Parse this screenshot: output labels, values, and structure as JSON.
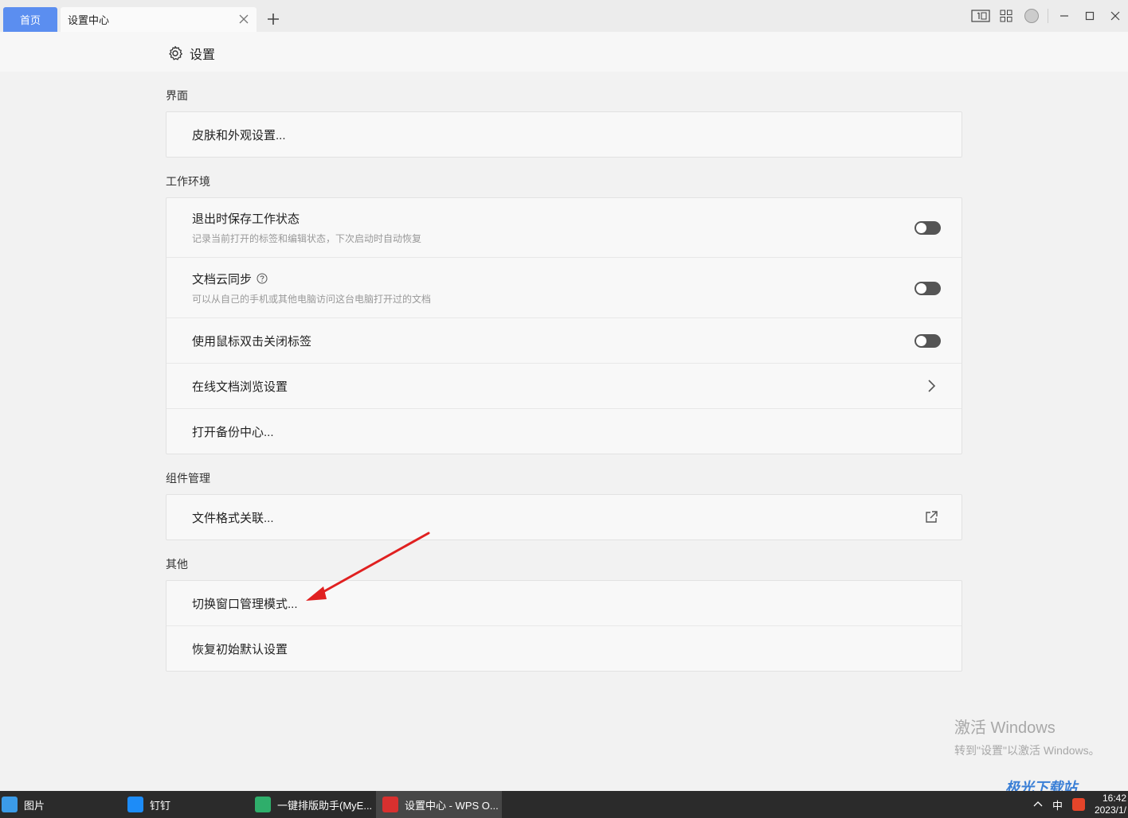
{
  "titlebar": {
    "home_tab": "首页",
    "active_tab": "设置中心"
  },
  "header": {
    "title": "设置"
  },
  "sections": {
    "interface": {
      "title": "界面",
      "skin": "皮肤和外观设置..."
    },
    "workspace": {
      "title": "工作环境",
      "save_state": {
        "label": "退出时保存工作状态",
        "desc": "记录当前打开的标签和编辑状态，下次启动时自动恢复"
      },
      "cloud_sync": {
        "label": "文档云同步",
        "desc": "可以从自己的手机或其他电脑访问这台电脑打开过的文档"
      },
      "dblclick_close": {
        "label": "使用鼠标双击关闭标签"
      },
      "online_browse": {
        "label": "在线文档浏览设置"
      },
      "backup": {
        "label": "打开备份中心..."
      }
    },
    "components": {
      "title": "组件管理",
      "file_assoc": "文件格式关联..."
    },
    "other": {
      "title": "其他",
      "switch_window": "切换窗口管理模式...",
      "restore_default": "恢复初始默认设置"
    }
  },
  "watermark": {
    "activate_title": "激活 Windows",
    "activate_sub": "转到\"设置\"以激活 Windows。",
    "site": "极光下载站"
  },
  "taskbar": {
    "items": [
      "图片",
      "钉钉",
      "一键排版助手(MyE...",
      "设置中心 - WPS O..."
    ],
    "ime": "中",
    "time": "16:42",
    "date": "2023/1/"
  },
  "colors": {
    "home_tab_bg": "#5b8ef0",
    "toggle_off": "#555555",
    "arrow": "#e02020"
  }
}
